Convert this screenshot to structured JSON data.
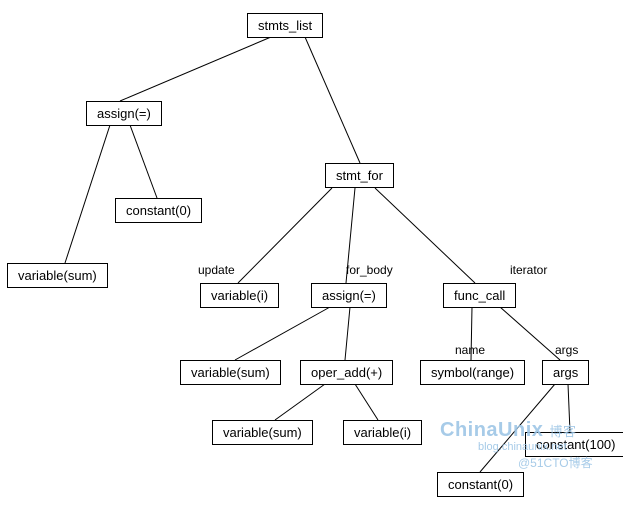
{
  "nodes": {
    "stmts_list": "stmts_list",
    "assign1": "assign(=)",
    "const0a": "constant(0)",
    "var_sum1": "variable(sum)",
    "stmt_for": "stmt_for",
    "var_i1": "variable(i)",
    "assign2": "assign(=)",
    "func_call": "func_call",
    "var_sum2": "variable(sum)",
    "oper_add": "oper_add(+)",
    "var_sum3": "variable(sum)",
    "var_i2": "variable(i)",
    "symbol_range": "symbol(range)",
    "args": "args",
    "const0b": "constant(0)",
    "const100": "constant(100)"
  },
  "edge_labels": {
    "update": "update",
    "for_body": "for_body",
    "iterator": "iterator",
    "name": "name",
    "args": "args"
  },
  "watermark": {
    "brand": "ChinaUnix",
    "sub1": "博客",
    "sub2": "blog.chinaunix.net",
    "sub3": "@51CTO博客"
  }
}
